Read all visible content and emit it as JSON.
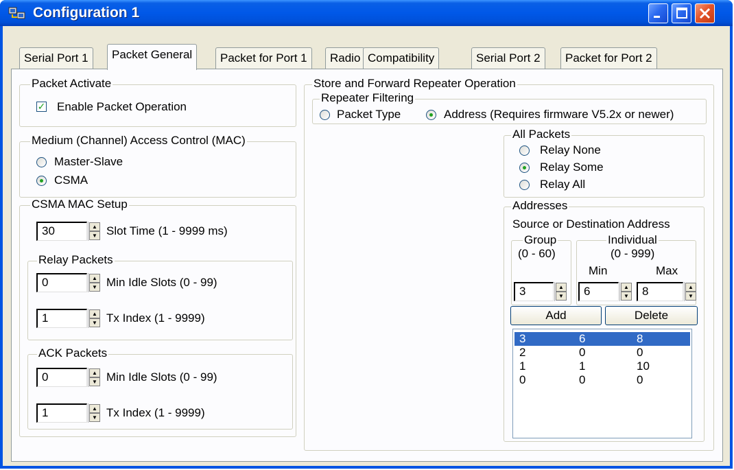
{
  "window": {
    "title": "Configuration 1"
  },
  "tabs": [
    "Serial Port 1",
    "Packet General",
    "Packet for Port 1",
    "Radio",
    "Compatibility",
    "Serial Port 2",
    "Packet for Port 2"
  ],
  "packet_activate": {
    "title": "Packet Activate",
    "enable_label": "Enable Packet Operation",
    "enabled": true
  },
  "mac": {
    "title": "Medium (Channel) Access Control (MAC)",
    "master_slave": "Master-Slave",
    "csma": "CSMA",
    "selected": "CSMA"
  },
  "csma_setup": {
    "title": "CSMA MAC Setup",
    "slot_time_value": "30",
    "slot_time_label": "Slot Time (1 - 9999 ms)",
    "relay": {
      "title": "Relay Packets",
      "min_idle_value": "0",
      "min_idle_label": "Min Idle Slots  (0 - 99)",
      "tx_index_value": "1",
      "tx_index_label": "Tx Index  (1 - 9999)"
    },
    "ack": {
      "title": "ACK Packets",
      "min_idle_value": "0",
      "min_idle_label": "Min Idle Slots  (0 - 99)",
      "tx_index_value": "1",
      "tx_index_label": "Tx Index  (1 - 9999)"
    }
  },
  "store_forward": {
    "title": "Store and Forward Repeater Operation",
    "filtering": {
      "title": "Repeater Filtering",
      "packet_type": "Packet Type",
      "address": "Address (Requires firmware V5.2x or newer)",
      "selected": "Address"
    },
    "all_packets": {
      "title": "All Packets",
      "relay_none": "Relay None",
      "relay_some": "Relay Some",
      "relay_all": "Relay All",
      "selected": "Relay Some"
    },
    "addresses": {
      "title": "Addresses",
      "subtitle": "Source or Destination Address",
      "group_title": "Group",
      "group_range": "(0 - 60)",
      "individual_title": "Individual",
      "individual_range": "(0 - 999)",
      "min_label": "Min",
      "max_label": "Max",
      "group_value": "3",
      "min_value": "6",
      "max_value": "8",
      "add_label": "Add",
      "delete_label": "Delete",
      "rows": [
        [
          "3",
          "6",
          "8"
        ],
        [
          "2",
          "0",
          "0"
        ],
        [
          "1",
          "1",
          "10"
        ],
        [
          "0",
          "0",
          "0"
        ]
      ],
      "selected_row": 0
    }
  },
  "colors": {
    "title_bar": "#0054e3",
    "dialog_bg": "#ece9d8",
    "panel_bg": "#fcfcfe",
    "selection": "#316ac5",
    "radio_dot": "#21a121"
  }
}
